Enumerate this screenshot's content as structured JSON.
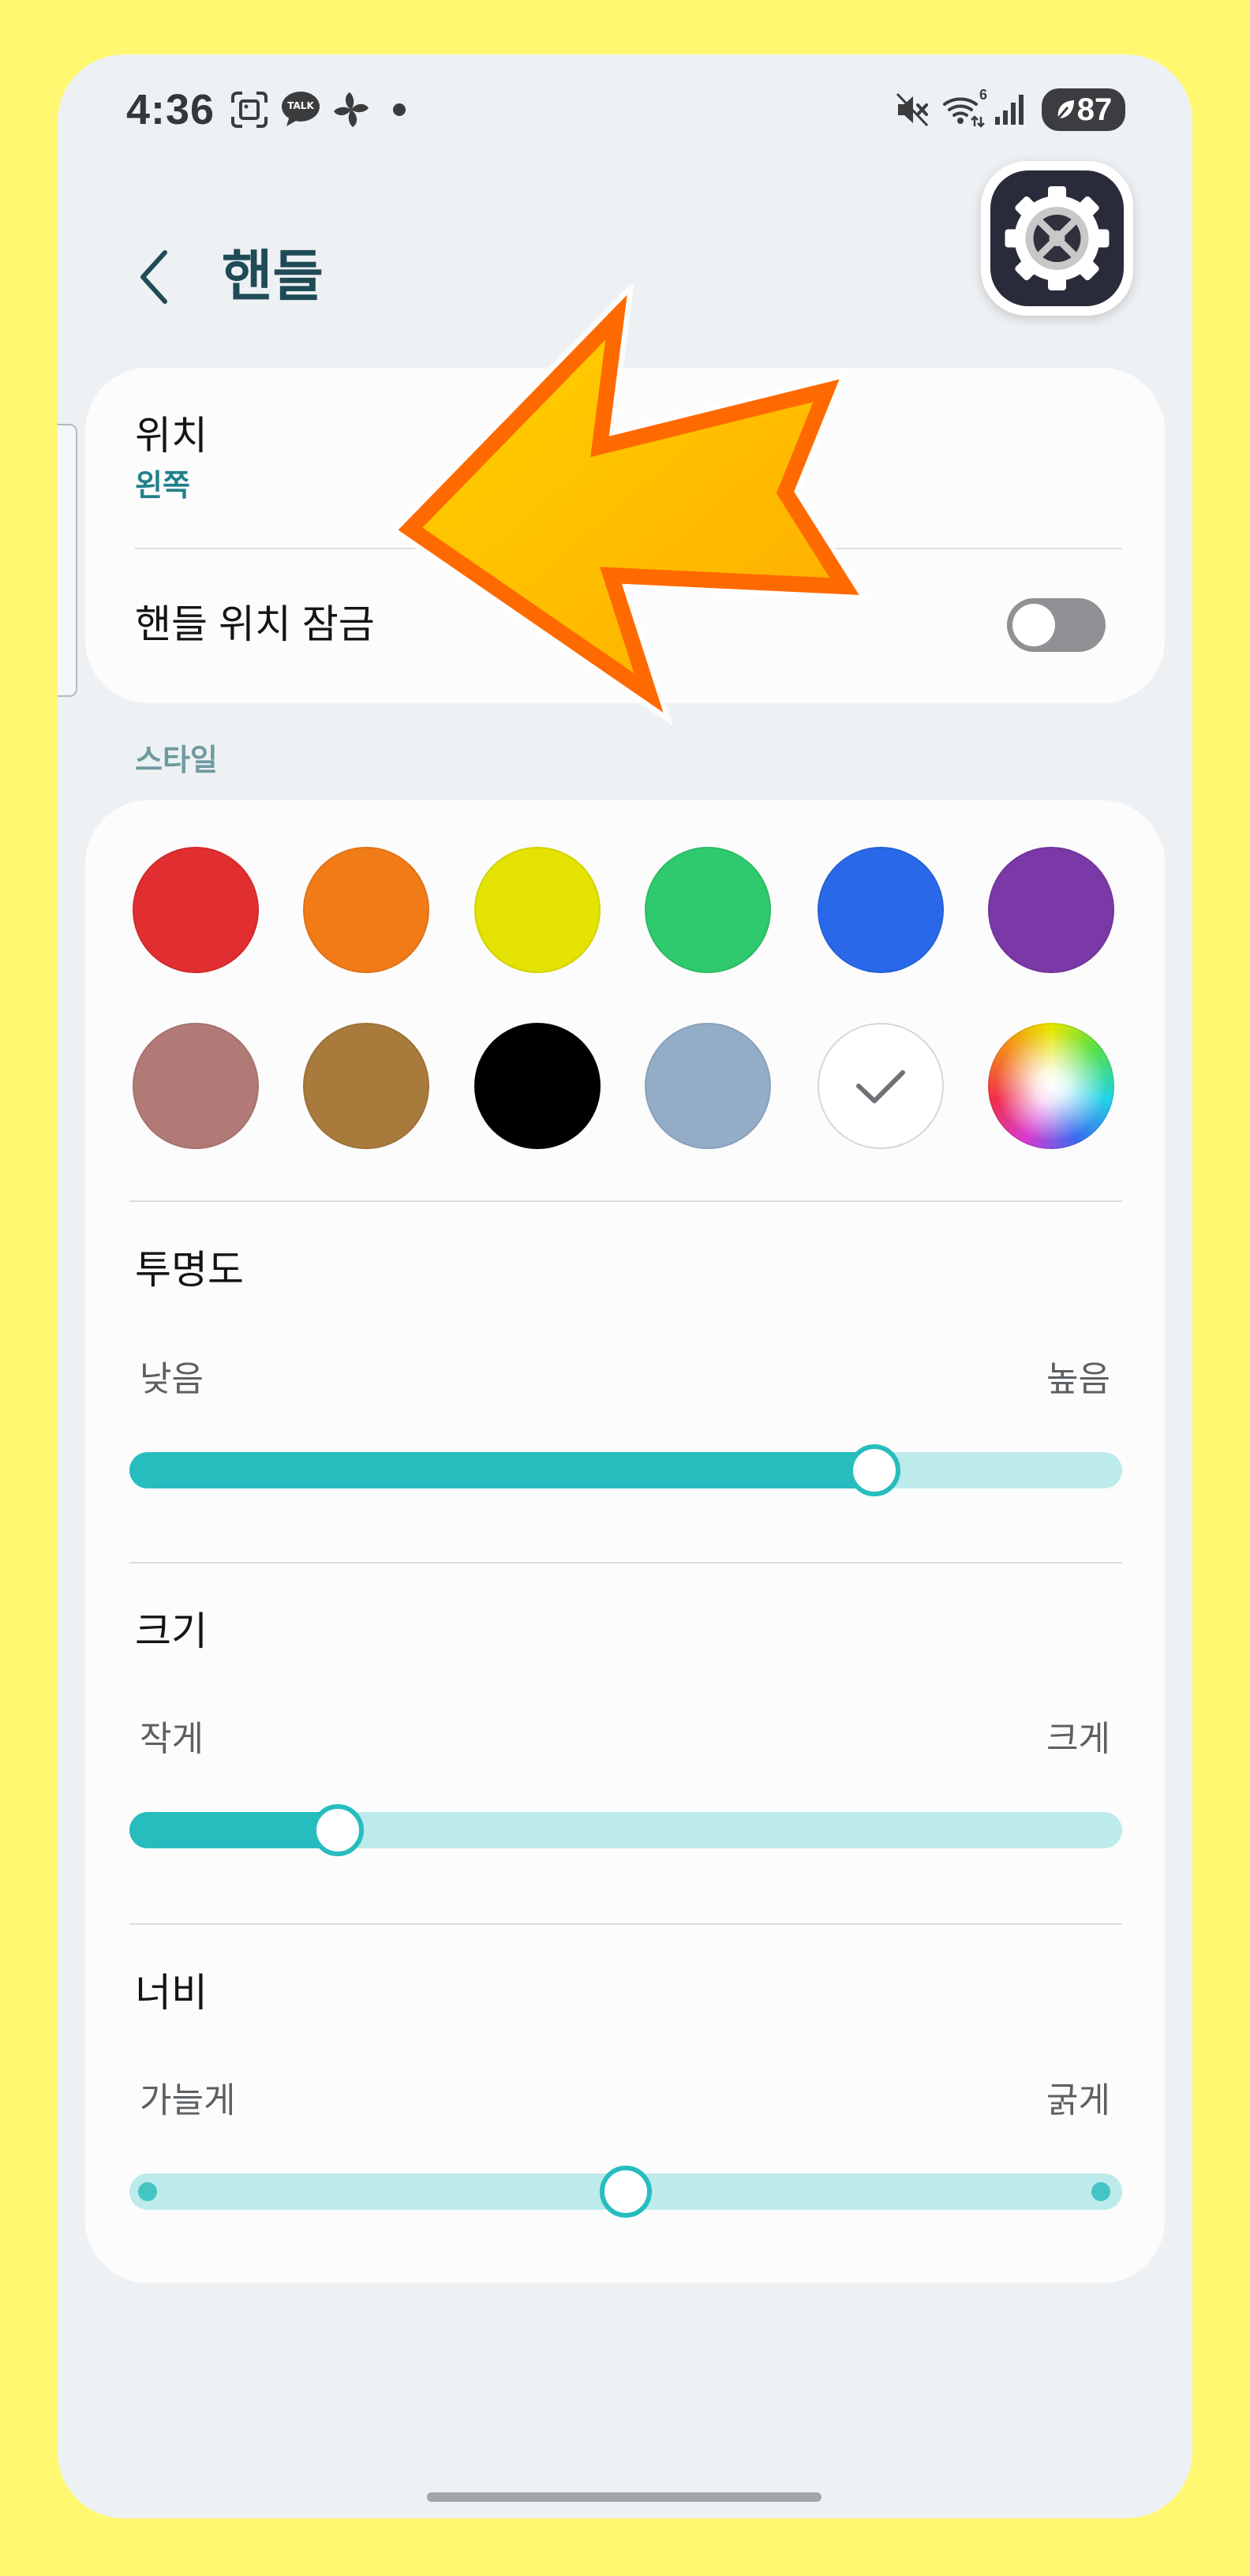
{
  "status_bar": {
    "time": "4:36",
    "talk_label": "TALK",
    "wifi_badge": "6",
    "battery_level": "87",
    "icons": {
      "screenshot": "screenshot-icon",
      "kakaotalk": "kakaotalk-icon",
      "pinwheel": "pinwheel-icon",
      "notification_dot": "dot-icon",
      "mute": "mute-icon",
      "wifi": "wifi-icon",
      "signal": "signal-icon",
      "battery": "battery-icon",
      "battery_saver": "leaf-icon"
    }
  },
  "header": {
    "back_icon": "chevron-left-icon",
    "title": "핸들",
    "app_icon": "settings-gear-icon"
  },
  "edge_handle": {
    "icon": "up-down-chevron-icon"
  },
  "position_card": {
    "position_label": "위치",
    "position_value": "왼쪽",
    "lock_label": "핸들 위치 잠금",
    "lock_enabled": false
  },
  "style_section": {
    "section_label": "스타일",
    "swatch_colors": [
      "#e12e30",
      "#f17b17",
      "#e3e200",
      "#2fca6d",
      "#2868e9",
      "#7b38a7",
      "#b27a77",
      "#a87b3c",
      "#000000",
      "#93adc7",
      "#ffffff"
    ],
    "selected_swatch": 10,
    "check_icon": "checkmark-icon",
    "custom_color_icon": "color-wheel-icon"
  },
  "sliders": {
    "transparency": {
      "label": "투명도",
      "min_label": "낮음",
      "max_label": "높음",
      "value": 0.75
    },
    "size": {
      "label": "크기",
      "min_label": "작게",
      "max_label": "크게",
      "value": 0.21
    },
    "width": {
      "label": "너비",
      "min_label": "가늘게",
      "max_label": "굵게",
      "value": 0.5
    }
  },
  "annotation": {
    "icon": "annotation-arrow-icon",
    "color": "#ff6a00"
  },
  "theme": {
    "accent": "#27bdbf",
    "track": "#bdeaea",
    "background": "#fff870"
  }
}
